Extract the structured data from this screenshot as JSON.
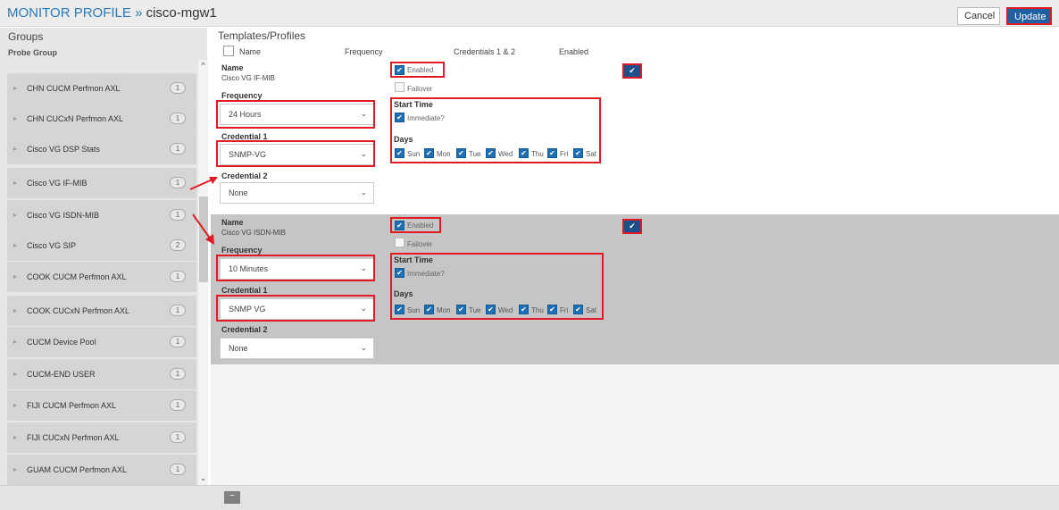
{
  "header": {
    "title": "MONITOR PROFILE »",
    "device": "cisco-mgw1",
    "cancel_label": "Cancel",
    "update_label": "Update"
  },
  "groups": {
    "title": "Groups",
    "column_label": "Probe Group",
    "items": [
      {
        "name": "CHN CUCM Perfmon AXL",
        "count": "1"
      },
      {
        "name": "CHN CUCxN Perfmon AXL",
        "count": "1"
      },
      {
        "name": "Cisco VG DSP Stats",
        "count": "1"
      },
      {
        "name": "Cisco VG IF-MIB",
        "count": "1"
      },
      {
        "name": "Cisco VG ISDN-MIB",
        "count": "1"
      },
      {
        "name": "Cisco VG SIP",
        "count": "2"
      },
      {
        "name": "COOK CUCM Perfmon AXL",
        "count": "1"
      },
      {
        "name": "COOK CUCxN Perfmon AXL",
        "count": "1"
      },
      {
        "name": "CUCM Device Pool",
        "count": "1"
      },
      {
        "name": "CUCM-END USER",
        "count": "1"
      },
      {
        "name": "FIJI CUCM Perfmon AXL",
        "count": "1"
      },
      {
        "name": "FIJI CUCxN Perfmon AXL",
        "count": "1"
      },
      {
        "name": "GUAM CUCM Perfmon AXL",
        "count": "1"
      }
    ]
  },
  "templates": {
    "title": "Templates/Profiles",
    "columns": {
      "name": "Name",
      "frequency": "Frequency",
      "credentials": "Credentials 1 & 2",
      "enabled": "Enabled"
    }
  },
  "labels": {
    "name": "Name",
    "frequency": "Frequency",
    "credential1": "Credential 1",
    "credential2": "Credential 2",
    "enabled": "Enabled",
    "failover": "Failover",
    "start_time": "Start Time",
    "immediate": "Immediate?",
    "days": "Days"
  },
  "days": [
    "Sun",
    "Mon",
    "Tue",
    "Wed",
    "Thu",
    "Fri",
    "Sat"
  ],
  "profiles": [
    {
      "name": "Cisco VG IF-MIB",
      "frequency": "24 Hours",
      "credential1": "SNMP-VG",
      "credential2": "None"
    },
    {
      "name": "Cisco VG ISDN-MIB",
      "frequency": "10 Minutes",
      "credential1": "SNMP VG",
      "credential2": "None"
    }
  ],
  "footer": {
    "minus_label": "−"
  },
  "icons": {
    "check": "✔",
    "caret_down": "⌄",
    "triangle_right": "▸",
    "scroll_up": "^",
    "scroll_down": "⌄"
  },
  "colors": {
    "accent": "#1f6fb5",
    "highlight": "#e01b24",
    "title": "#2a7ab9",
    "selected_panel": "#c5c5c5"
  }
}
